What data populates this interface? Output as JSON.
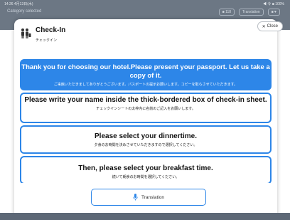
{
  "status_bar": {
    "time": "14:26 4月13日(木)",
    "indicators": "◀ 令 ■ 100%"
  },
  "app_bar": {
    "category": "Category selected",
    "badge1": "■ 118",
    "badge2": "Translation",
    "badge3": "■ ♥"
  },
  "modal": {
    "title": "Check-In",
    "subtitle": "チェックイン",
    "close_label": "Close"
  },
  "steps": [
    {
      "en": "Thank you for choosing our hotel.Please present your passport. Let us take a copy of it.",
      "ja": "ご来館いただきましてありがとうございます。パスポートの提示お願いします。コピーを取らさせていただきます。"
    },
    {
      "en": "Please write your name inside the thick-bordered box of check-in sheet.",
      "ja": "チェックインシートの太枠内に名前のご記入をお願いします。"
    },
    {
      "en": "Please select your dinnertime.",
      "ja": "夕食のお時間を決めさせていただきますので選択してください。"
    },
    {
      "en": "Then, please select your breakfast time.",
      "ja": "続いて朝食のお時間を選択してください。"
    }
  ],
  "translation_button": {
    "label": "Translation"
  },
  "colors": {
    "accent": "#2d86e8",
    "backdrop": "#6c7784"
  }
}
